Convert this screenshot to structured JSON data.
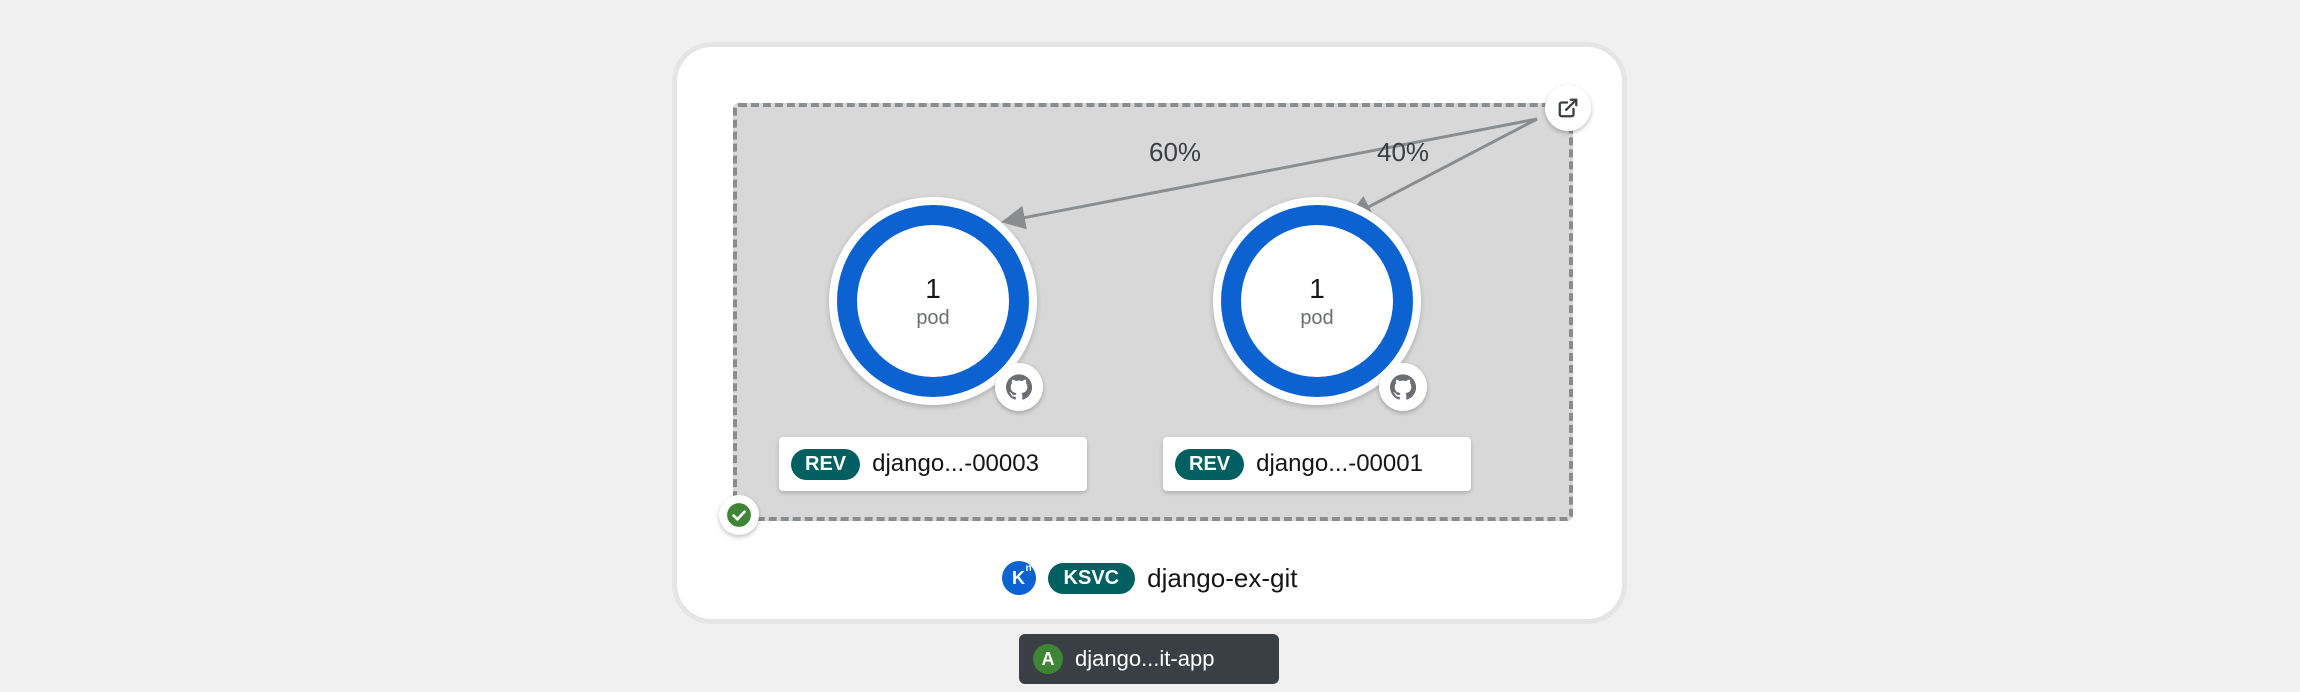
{
  "traffic": {
    "left_pct": "60%",
    "right_pct": "40%"
  },
  "pods": {
    "left": {
      "count": "1",
      "unit": "pod"
    },
    "right": {
      "count": "1",
      "unit": "pod"
    }
  },
  "revisions": {
    "badge": "REV",
    "left_name": "django...-00003",
    "right_name": "django...-00001"
  },
  "service": {
    "kn_letter": "K",
    "kn_sup": "n",
    "badge": "KSVC",
    "name": "django-ex-git"
  },
  "app": {
    "letter": "A",
    "name": "django...it-app"
  }
}
